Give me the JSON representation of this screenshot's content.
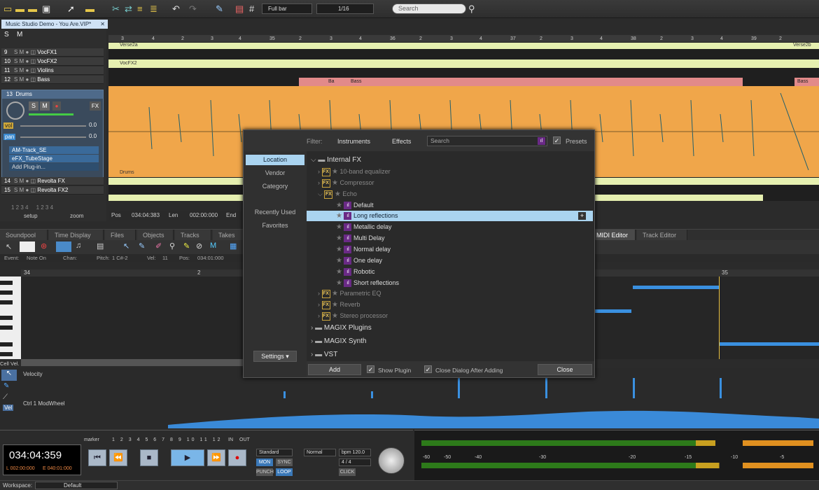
{
  "toolbar": {
    "zoom_mode": "Full bar",
    "quantize": "1/16",
    "search_placeholder": "Search"
  },
  "project": {
    "title": "Music Studio Demo - You Are.VIP*"
  },
  "tracks": [
    {
      "num": "9",
      "name": "VocFX1"
    },
    {
      "num": "10",
      "name": "VocFX2"
    },
    {
      "num": "11",
      "name": "Violins"
    },
    {
      "num": "12",
      "name": "Bass"
    },
    {
      "num": "13",
      "name": "Drums"
    },
    {
      "num": "14",
      "name": "Revolta FX"
    },
    {
      "num": "15",
      "name": "Revolta FX2"
    }
  ],
  "drums_panel": {
    "vol_label": "vol",
    "vol_value": "0.0",
    "pan_label": "pan",
    "pan_value": "0.0",
    "fx": [
      "AM-Track_SE",
      "eFX_TubeStage",
      "Add Plug-in..."
    ]
  },
  "track_footer": {
    "setup": "setup",
    "zoom": "zoom"
  },
  "ruler": [
    "3",
    "4",
    "2",
    "3",
    "4",
    "35",
    "2",
    "3",
    "4",
    "36",
    "2",
    "3",
    "4",
    "37",
    "2",
    "3",
    "4",
    "38",
    "2",
    "3",
    "4",
    "39",
    "2"
  ],
  "objects": {
    "verse_a": "Verse2a",
    "verse_b": "Verse2b",
    "vocfx2": "VocFX2",
    "bass_a": "Ba",
    "bass_b": "Bass",
    "bass_c": "Bass",
    "drums": "Drums"
  },
  "position_bar": {
    "pos_label": "Pos",
    "pos_value": "034:04:383",
    "len_label": "Len",
    "len_value": "002:00:000",
    "end_label": "End"
  },
  "dialog": {
    "filter_label": "Filter:",
    "instruments": "Instruments",
    "effects": "Effects",
    "search_placeholder": "Search",
    "presets": "Presets",
    "nav": [
      "Location",
      "Vendor",
      "Category",
      "Recently Used",
      "Favorites"
    ],
    "settings": "Settings",
    "tree": {
      "internal_fx": "Internal FX",
      "items": [
        "10-band equalizer",
        "Compressor",
        "Echo"
      ],
      "echo_presets": [
        "Default",
        "Long reflections",
        "Metallic delay",
        "Multi Delay",
        "Normal delay",
        "One delay",
        "Robotic",
        "Short reflections"
      ],
      "items2": [
        "Parametric EQ",
        "Reverb",
        "Stereo processor"
      ],
      "folders": [
        "MAGIX Plugins",
        "MAGIX Synth",
        "VST"
      ]
    },
    "add": "Add",
    "show_plugin": "Show Plugin",
    "close_after": "Close Dialog After Adding",
    "close": "Close"
  },
  "lower_tabs": [
    "Soundpool",
    "Time Display",
    "Files",
    "Objects",
    "Tracks",
    "Takes",
    "MIDI Editor",
    "Track Editor"
  ],
  "event_row": {
    "event_label": "Event:",
    "event_value": "Note On",
    "chan_label": "Chan:",
    "pitch_label": "Pitch:",
    "pitch_value": "1 C#-2",
    "vel_label": "Vel:",
    "vel_value": "11",
    "pos_label": "Pos:",
    "pos_value": "034:01:000"
  },
  "midi_ruler": [
    "34",
    "2",
    "35"
  ],
  "velocity": {
    "cell_label": "Cell Vel.",
    "velocity": "Velocity",
    "ctrl": "Ctrl 1 ModWheel",
    "vel": "Vel"
  },
  "transport": {
    "time": "034:04:359",
    "l_time": "002:00:000",
    "e_time": "040:01:000",
    "marker": "marker",
    "markers": [
      "1",
      "2",
      "3",
      "4",
      "5",
      "6",
      "7",
      "8",
      "9",
      "10",
      "11",
      "12"
    ],
    "in": "IN",
    "out": "OUT",
    "mode": "Standard",
    "mon": "MON",
    "sync": "SYNC",
    "punch": "PUNCH",
    "loop": "LOOP",
    "normal": "Normal",
    "bpm": "bpm 120.0",
    "sig": "4 / 4",
    "click": "CLICK"
  },
  "meter_scale": [
    "-60",
    "-50",
    "-40",
    "-30",
    "-20",
    "-15",
    "-10",
    "-5"
  ],
  "status": {
    "workspace_label": "Workspace:",
    "workspace": "Default"
  }
}
